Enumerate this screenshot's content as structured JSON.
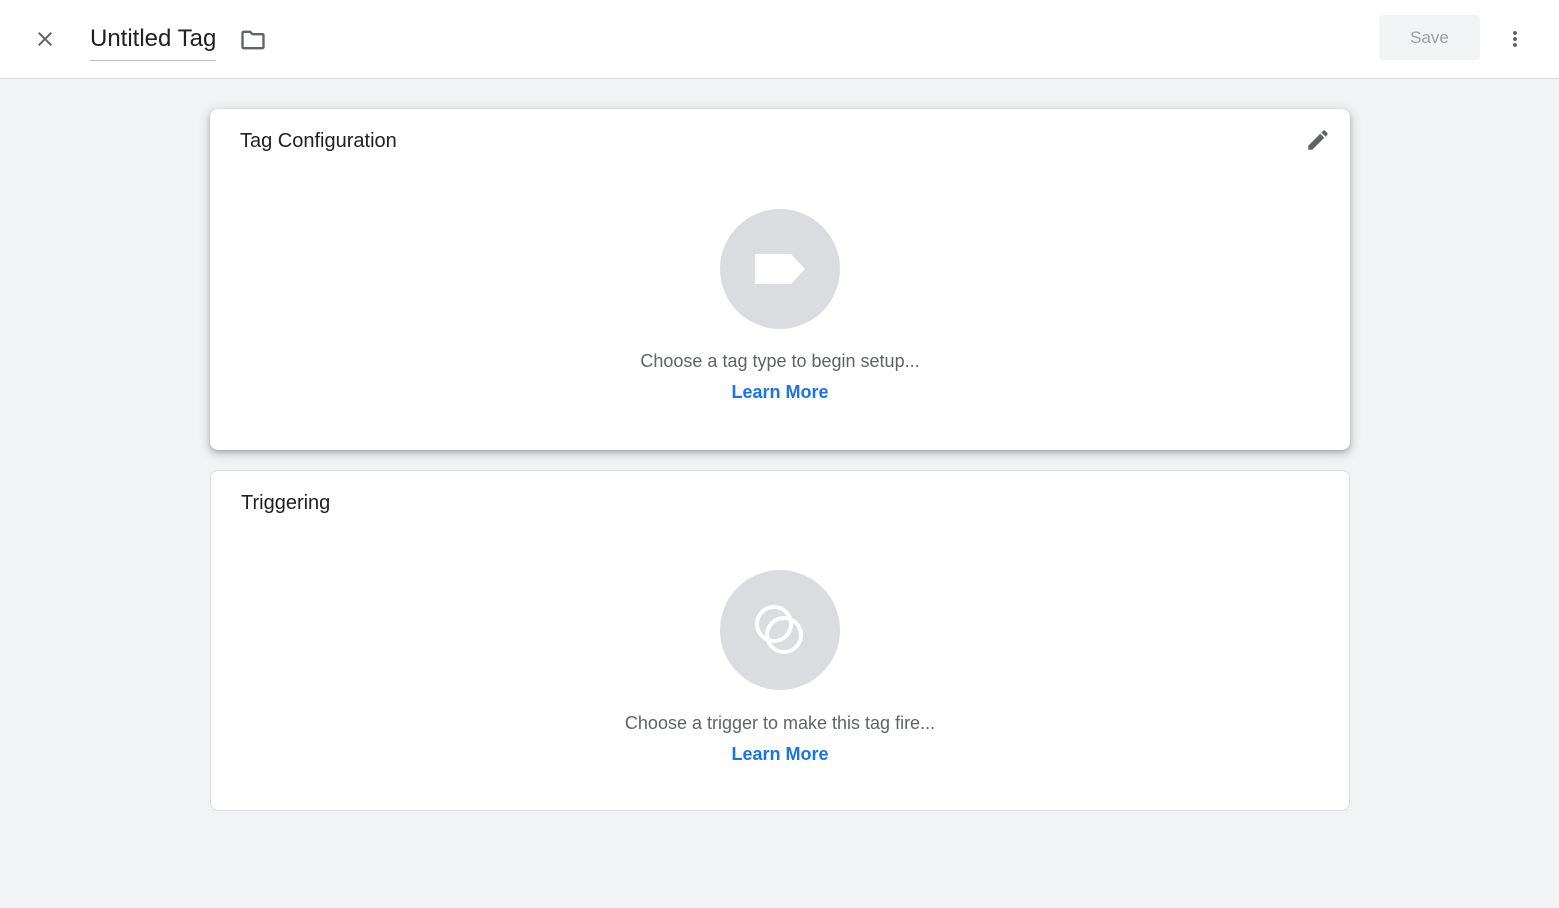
{
  "header": {
    "title": "Untitled Tag",
    "save_label": "Save"
  },
  "tag_configuration": {
    "title": "Tag Configuration",
    "hint": "Choose a tag type to begin setup...",
    "link": "Learn More"
  },
  "triggering": {
    "title": "Triggering",
    "hint": "Choose a trigger to make this tag fire...",
    "link": "Learn More"
  },
  "icons": {
    "close": "close-icon",
    "folder": "folder-icon",
    "more": "more-vert-icon",
    "edit": "pencil-icon",
    "tag": "tag-icon",
    "trigger": "trigger-icon"
  },
  "colors": {
    "accent": "#1a73e8",
    "background": "#f1f3f4",
    "placeholder_circle": "#dadce0"
  }
}
